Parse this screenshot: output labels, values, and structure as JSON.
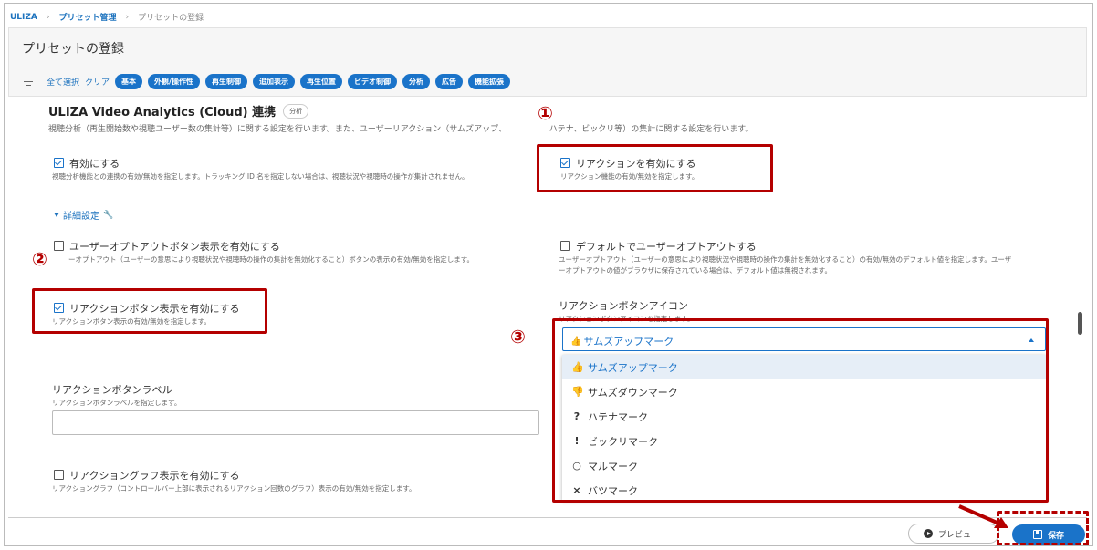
{
  "breadcrumb": {
    "root": "ULIZA",
    "parent": "プリセット管理",
    "current": "プリセットの登録",
    "sep": "›"
  },
  "header": {
    "title": "プリセットの登録",
    "select_all": "全て選択",
    "clear": "クリア",
    "chips": [
      "基本",
      "外観/操作性",
      "再生制御",
      "追加表示",
      "再生位置",
      "ビデオ制御",
      "分析",
      "広告",
      "機能拡張"
    ]
  },
  "section": {
    "title": "ULIZA Video Analytics (Cloud) 連携",
    "tag": "分析",
    "description": "視聴分析（再生開始数や視聴ユーザー数の集計等）に関する設定を行います。また、ユーザーリアクション（サムズアップ、",
    "description_tail": "ハテナ、ビックリ等）の集計に関する設定を行います。"
  },
  "options": {
    "enable": {
      "label": "有効にする",
      "sub": "視聴分析機能との連携の有効/無効を指定します。トラッキング ID 名を指定しない場合は、視聴状況や視聴時の操作が集計されません。",
      "checked": true
    },
    "enable_reaction": {
      "label": "リアクションを有効にする",
      "sub": "リアクション機能の有効/無効を指定します。",
      "checked": true
    },
    "advanced": "詳細設定",
    "optout_button": {
      "label": "ユーザーオプトアウトボタン表示を有効にする",
      "sub": "ーオプトアウト（ユーザーの意思により視聴状況や視聴時の操作の集計を無効化すること）ボタンの表示の有効/無効を指定します。",
      "checked": false
    },
    "default_optout": {
      "label": "デフォルトでユーザーオプトアウトする",
      "sub1": "ユーザーオプトアウト（ユーザーの意思により視聴状況や視聴時の操作の集計を無効化すること）の有効/無効のデフォルト値を指定します。ユーザ",
      "sub2": "ーオプトアウトの値がブラウザに保存されている場合は、デフォルト値は無視されます。",
      "checked": false
    },
    "reaction_button": {
      "label": "リアクションボタン表示を有効にする",
      "sub": "リアクションボタン表示の有効/無効を指定します。",
      "checked": true
    },
    "reaction_icon": {
      "label": "リアクションボタンアイコン",
      "sub": "リアクションボタンアイコンを指定します。"
    },
    "reaction_label": {
      "label": "リアクションボタンラベル",
      "sub": "リアクションボタンラベルを指定します。",
      "value": ""
    },
    "reaction_graph": {
      "label": "リアクショングラフ表示を有効にする",
      "sub": "リアクショングラフ（コントロールバー上部に表示されるリアクション回数のグラフ）表示の有効/無効を指定します。",
      "checked": false
    }
  },
  "dropdown": {
    "selected": "サムズアップマーク",
    "options": [
      {
        "icon": "thumbs-up-icon",
        "glyph": "👍",
        "label": "サムズアップマーク"
      },
      {
        "icon": "thumbs-down-icon",
        "glyph": "👎",
        "label": "サムズダウンマーク"
      },
      {
        "icon": "question-icon",
        "glyph": "?",
        "label": "ハテナマーク"
      },
      {
        "icon": "exclamation-icon",
        "glyph": "!",
        "label": "ビックリマーク"
      },
      {
        "icon": "circle-icon",
        "glyph": "○",
        "label": "マルマーク"
      },
      {
        "icon": "cross-icon",
        "glyph": "×",
        "label": "バツマーク"
      }
    ]
  },
  "annotations": {
    "n1": "①",
    "n2": "②",
    "n3": "③"
  },
  "footer": {
    "preview": "プレビュー",
    "save": "保存"
  },
  "colors": {
    "accent": "#1a73c9",
    "highlight": "#b40000"
  }
}
